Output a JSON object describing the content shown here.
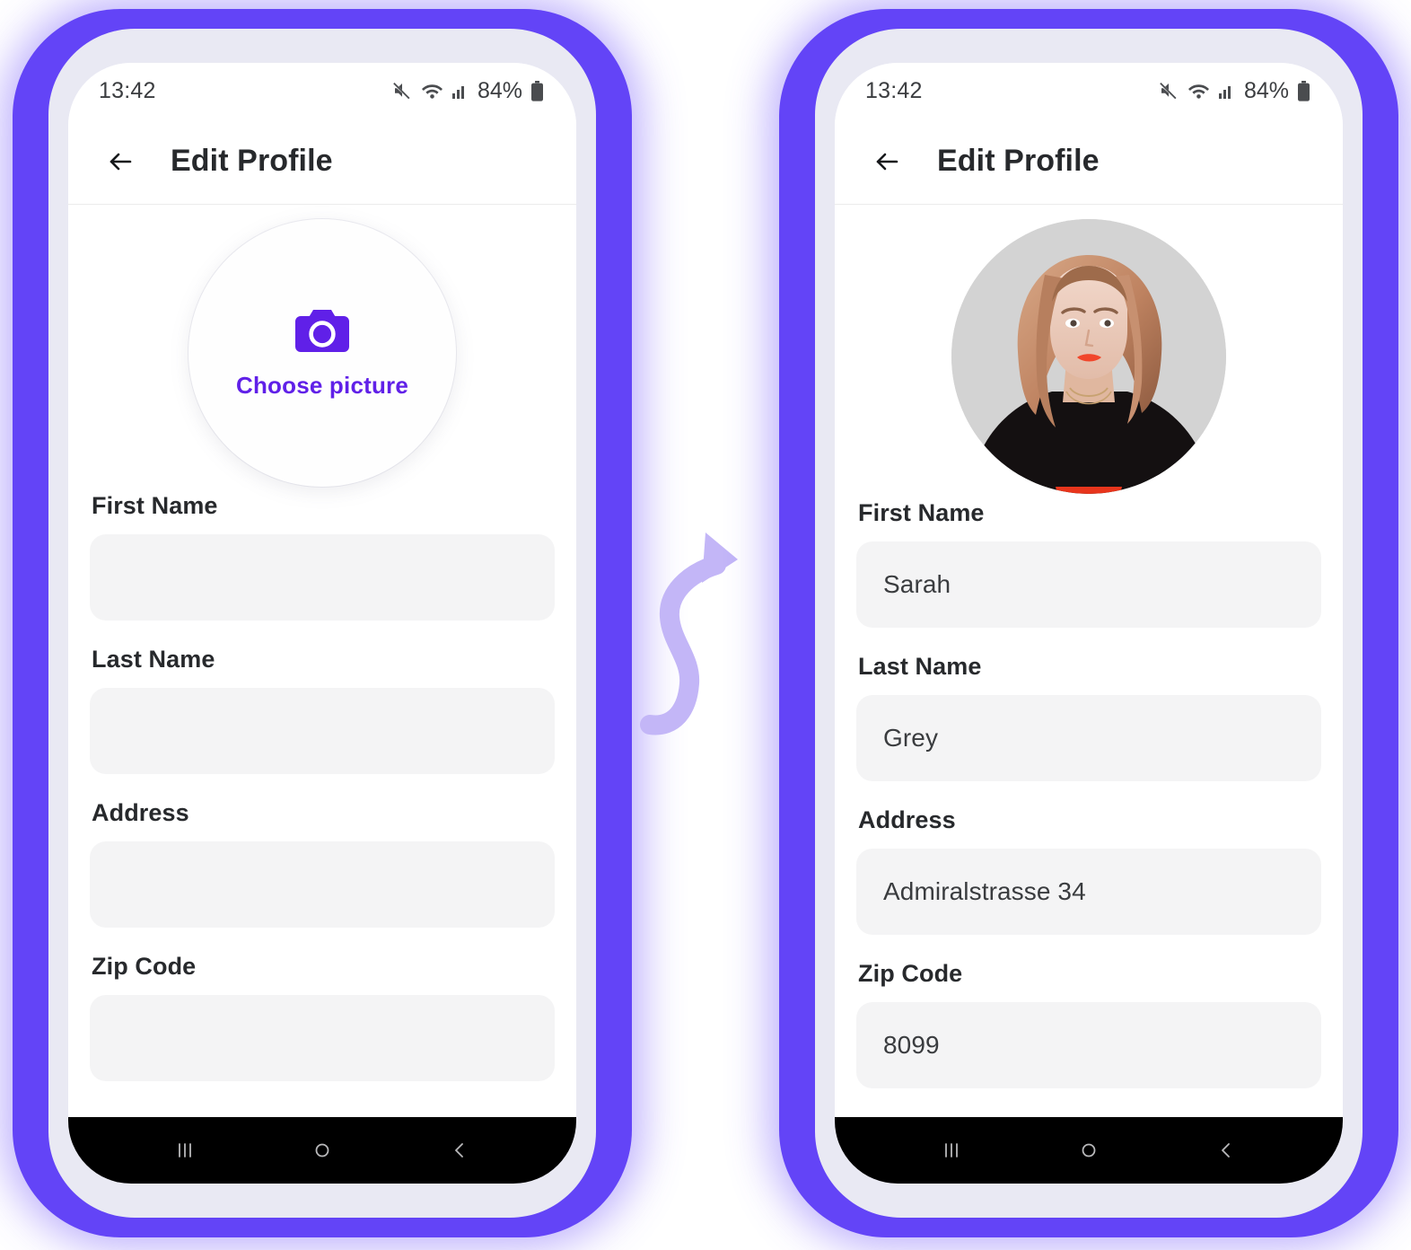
{
  "theme": {
    "accent_purple": "#6344F7",
    "icon_purple": "#6020E8",
    "frame_lavender": "#E9E9F3",
    "screen_white": "#FFFFFF",
    "field_gray": "#F4F4F5",
    "text_dark": "#27292C",
    "nav_black": "#000000",
    "arrow_lavender": "#C3B6F7",
    "avatar_bg_gray": "#D4D4D4"
  },
  "status_bar": {
    "time": "13:42",
    "battery_percent": "84%",
    "icons": [
      "mute-icon",
      "wifi-icon",
      "signal-bars-icon",
      "battery-icon"
    ]
  },
  "app_bar": {
    "back_icon": "arrow-left-icon",
    "title": "Edit Profile"
  },
  "nav_bar": {
    "recents_label": "recents-icon",
    "home_label": "home-icon",
    "back_label": "back-icon"
  },
  "screens": [
    {
      "id": "empty-state",
      "avatar": {
        "state": "empty",
        "icon": "camera-icon",
        "label": "Choose picture"
      },
      "fields": [
        {
          "label": "First Name",
          "value": "",
          "placeholder": ""
        },
        {
          "label": "Last Name",
          "value": "",
          "placeholder": ""
        },
        {
          "label": "Address",
          "value": "",
          "placeholder": ""
        },
        {
          "label": "Zip Code",
          "value": "",
          "placeholder": ""
        }
      ]
    },
    {
      "id": "filled-state",
      "avatar": {
        "state": "photo",
        "alt": "profile-photo-portrait"
      },
      "fields": [
        {
          "label": "First Name",
          "value": "Sarah",
          "placeholder": ""
        },
        {
          "label": "Last Name",
          "value": "Grey",
          "placeholder": ""
        },
        {
          "label": "Address",
          "value": "Admiralstrasse 34",
          "placeholder": ""
        },
        {
          "label": "Zip Code",
          "value": "8099",
          "placeholder": ""
        }
      ]
    }
  ],
  "flow": {
    "arrow_icon": "curved-arrow-right-icon"
  }
}
